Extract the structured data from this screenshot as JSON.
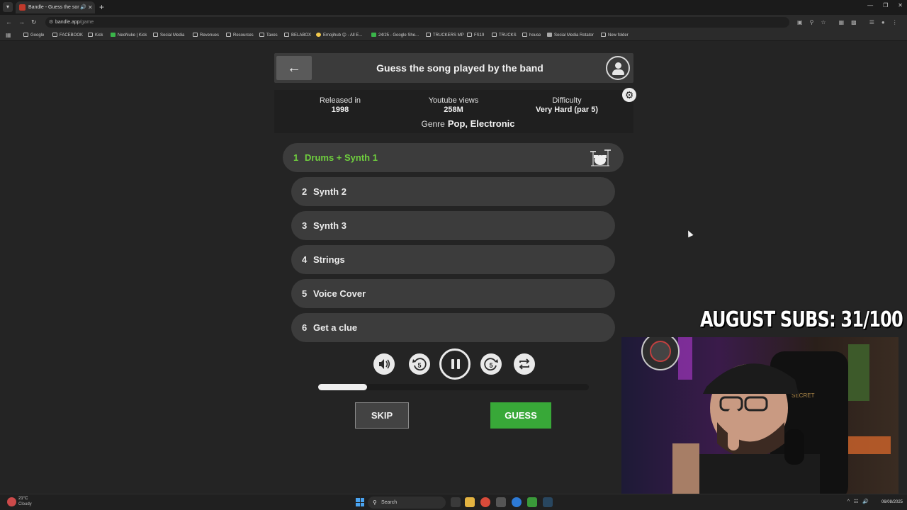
{
  "browser": {
    "tab_title": "Bandle - Guess the song, o",
    "url_host": "bandle.app",
    "url_path": "/game",
    "bookmarks": [
      "Google",
      "FACEBOOK",
      "Kick",
      "NeoNuke | Kick",
      "Social Media",
      "Revenues",
      "Resources",
      "Taxes",
      "BELABOX",
      "Emojihub 😊 - All E...",
      "24/25 - Google She...",
      "TRUCKERS MP",
      "FS19",
      "TRUCKS",
      "house",
      "Social Media Rotator",
      "New folder"
    ]
  },
  "game": {
    "title": "Guess the song played by the band",
    "info": {
      "released_label": "Released in",
      "released_value": "1998",
      "views_label": "Youtube views",
      "views_value": "258M",
      "difficulty_label": "Difficulty",
      "difficulty_value": "Very Hard (par 5)",
      "genre_label": "Genre",
      "genre_value": "Pop, Electronic"
    },
    "stems": [
      {
        "num": "1",
        "label": "Drums + Synth 1",
        "active": true
      },
      {
        "num": "2",
        "label": "Synth 2",
        "active": false
      },
      {
        "num": "3",
        "label": "Synth 3",
        "active": false
      },
      {
        "num": "4",
        "label": "Strings",
        "active": false
      },
      {
        "num": "5",
        "label": "Voice Cover",
        "active": false
      },
      {
        "num": "6",
        "label": "Get a clue",
        "active": false
      }
    ],
    "playback_progress": 0.18,
    "skip_label": "SKIP",
    "guess_label": "GUESS",
    "rewind_seconds": "5",
    "forward_seconds": "5"
  },
  "overlay": {
    "subs_text": "AUGUST SUBS: 31/100"
  },
  "taskbar": {
    "temperature": "21°C",
    "condition": "Cloudy",
    "search_placeholder": "Search",
    "date": "06/08/2025"
  },
  "colors": {
    "accent_green": "#6fcf3e",
    "guess_green": "#38a838",
    "background": "#242424"
  }
}
